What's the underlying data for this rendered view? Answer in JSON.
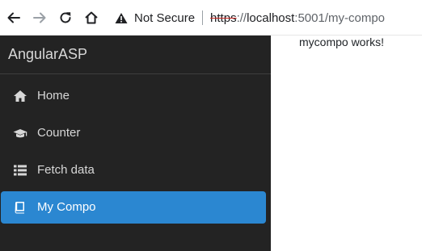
{
  "browser": {
    "back_icon": "arrow-left-icon",
    "forward_icon": "arrow-right-icon",
    "reload_icon": "reload-icon",
    "home_icon": "home-icon",
    "security_icon": "warning-triangle-icon",
    "security_label": "Not Secure",
    "url_scheme": "https",
    "url_separator": "://",
    "url_host": "localhost",
    "url_rest": ":5001/my-compo"
  },
  "sidebar": {
    "brand": "AngularASP",
    "items": [
      {
        "label": "Home",
        "icon": "home-icon",
        "active": false
      },
      {
        "label": "Counter",
        "icon": "graduation-cap-icon",
        "active": false
      },
      {
        "label": "Fetch data",
        "icon": "list-icon",
        "active": false
      },
      {
        "label": "My Compo",
        "icon": "book-icon",
        "active": true
      }
    ]
  },
  "main": {
    "text": "mycompo works!"
  },
  "colors": {
    "sidebar_bg": "#232323",
    "active_bg": "#2b87d1",
    "nav_text": "#d7d7d7"
  }
}
